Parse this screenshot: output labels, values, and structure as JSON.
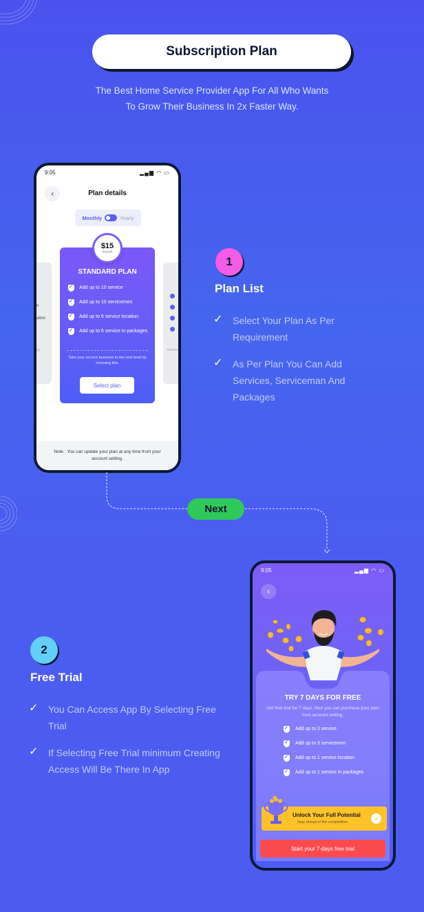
{
  "header": {
    "title": "Subscription Plan",
    "subtitle_line1": "The Best Home Service Provider App For All Who Wants",
    "subtitle_line2": "To Grow Their Business In 2x Faster Way."
  },
  "colors": {
    "background": "#4a5df0",
    "step1_badge": "#f35ce6",
    "step2_badge": "#61cff6",
    "next_pill": "#2ec95a",
    "plan_card_top": "#7b58f8",
    "plan_card_bottom": "#4c5ef7",
    "unlock_banner": "#ffc229",
    "trial_button": "#fb4a4f"
  },
  "phone1": {
    "status_time": "9:05",
    "status_icons": "signal wifi battery",
    "title": "Plan details",
    "toggle": {
      "left": "Monthly",
      "right": "Yearly",
      "selected": "Monthly"
    },
    "price": "$15",
    "price_period": "/month",
    "plan_name": "STANDARD PLAN",
    "features": [
      "Add up to 10 service",
      "Add up to 10 servicemen",
      "Add up to 6 service location",
      "Add up to 6 service in packages"
    ],
    "description": "Take your service business to the next level by choosing this.",
    "select_button": "Select plan",
    "side_left_fragments": [
      "n",
      "ation",
      "by"
    ],
    "side_right_fragment": "Stream",
    "note": "Note : You can update your plan at any time from your account setting."
  },
  "steps": [
    {
      "number": "1",
      "title": "Plan List",
      "points": [
        "Select Your Plan As Per Requirement",
        "As Per Plan You Can Add Services, Serviceman And Packages"
      ]
    },
    {
      "number": "2",
      "title": "Free Trial",
      "points": [
        "You Can Access App By Selecting Free Trial",
        "If Selecting Free Trial minimum Creating Access Will Be There In App"
      ]
    }
  ],
  "connector": {
    "label": "Next"
  },
  "phone2": {
    "status_time": "9:05",
    "status_icons": "signal wifi battery",
    "trial_title": "TRY 7 DAYS FOR FREE",
    "trial_description": "Get free trial for 7 days, then you can purchase your plan from account setting.",
    "features": [
      "Add up to 3 service",
      "Add up to 3 servicemen",
      "Add up to 1 service location",
      "Add up to 1 service in packages"
    ],
    "unlock_title": "Unlock Your Full Potential",
    "unlock_subtitle": "Stay ahead of the competition",
    "trial_button": "Start your 7-days free trial"
  },
  "icons": {
    "back": "‹",
    "check": "✓",
    "signal": "▂▄▆",
    "chevrons": "»"
  }
}
